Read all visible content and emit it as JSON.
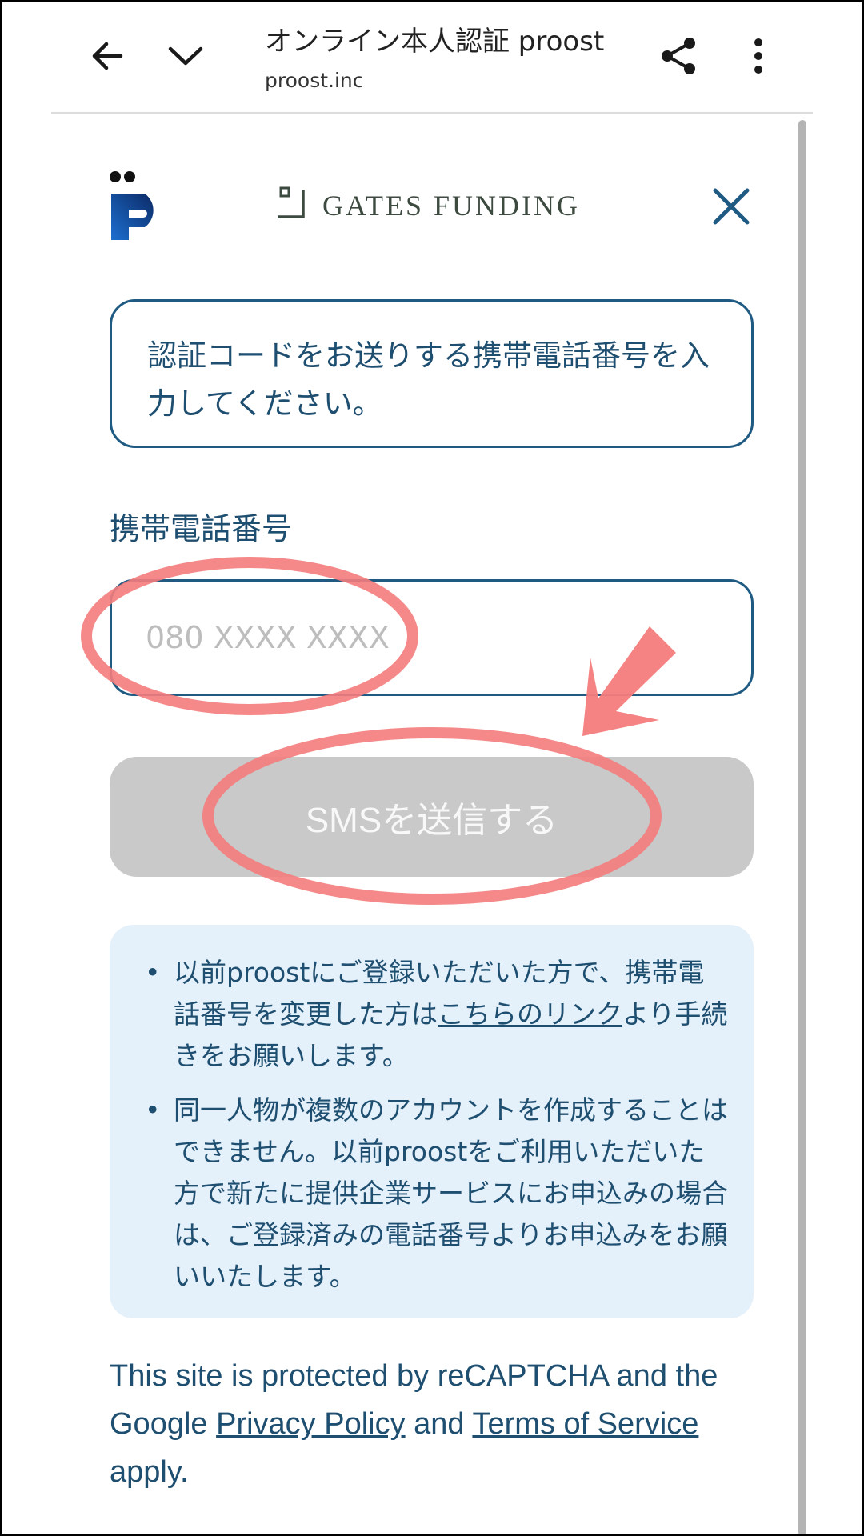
{
  "browser": {
    "title": "オンライン本人認証 proost",
    "url": "proost.inc",
    "icons": [
      "back-arrow-icon",
      "chevron-down-icon",
      "share-icon",
      "more-vert-icon"
    ]
  },
  "header": {
    "partner_logo_text": "GATES FUNDING"
  },
  "instruction": {
    "text": "認証コードをお送りする携帯電話番号を入力してください。"
  },
  "phone_field": {
    "label": "携帯電話番号",
    "placeholder": "080 XXXX XXXX",
    "value": ""
  },
  "submit": {
    "label": "SMSを送信する"
  },
  "notes": {
    "note1_before": "以前proostにご登録いただいた方で、携帯電話番号を変更した方は",
    "note1_link": "こちらのリンク",
    "note1_after": "より手続きをお願いします。",
    "note2": "同一人物が複数のアカウントを作成することはできません。以前proostをご利用いただいた方で新たに提供企業サービスにお申込みの場合は、ご登録済みの電話番号よりお申込みをお願いいたします。"
  },
  "recaptcha": {
    "prefix": "This site is protected by reCAPTCHA and the Google ",
    "privacy_link": "Privacy Policy",
    "and": " and ",
    "terms_link": "Terms of Service",
    "suffix": " apply."
  },
  "colors": {
    "primary": "#1f4f70",
    "border": "#1f5a82",
    "disabled_button": "#c9c9c9",
    "notes_bg": "#e4f0fa",
    "annotation": "#f47c7c"
  }
}
